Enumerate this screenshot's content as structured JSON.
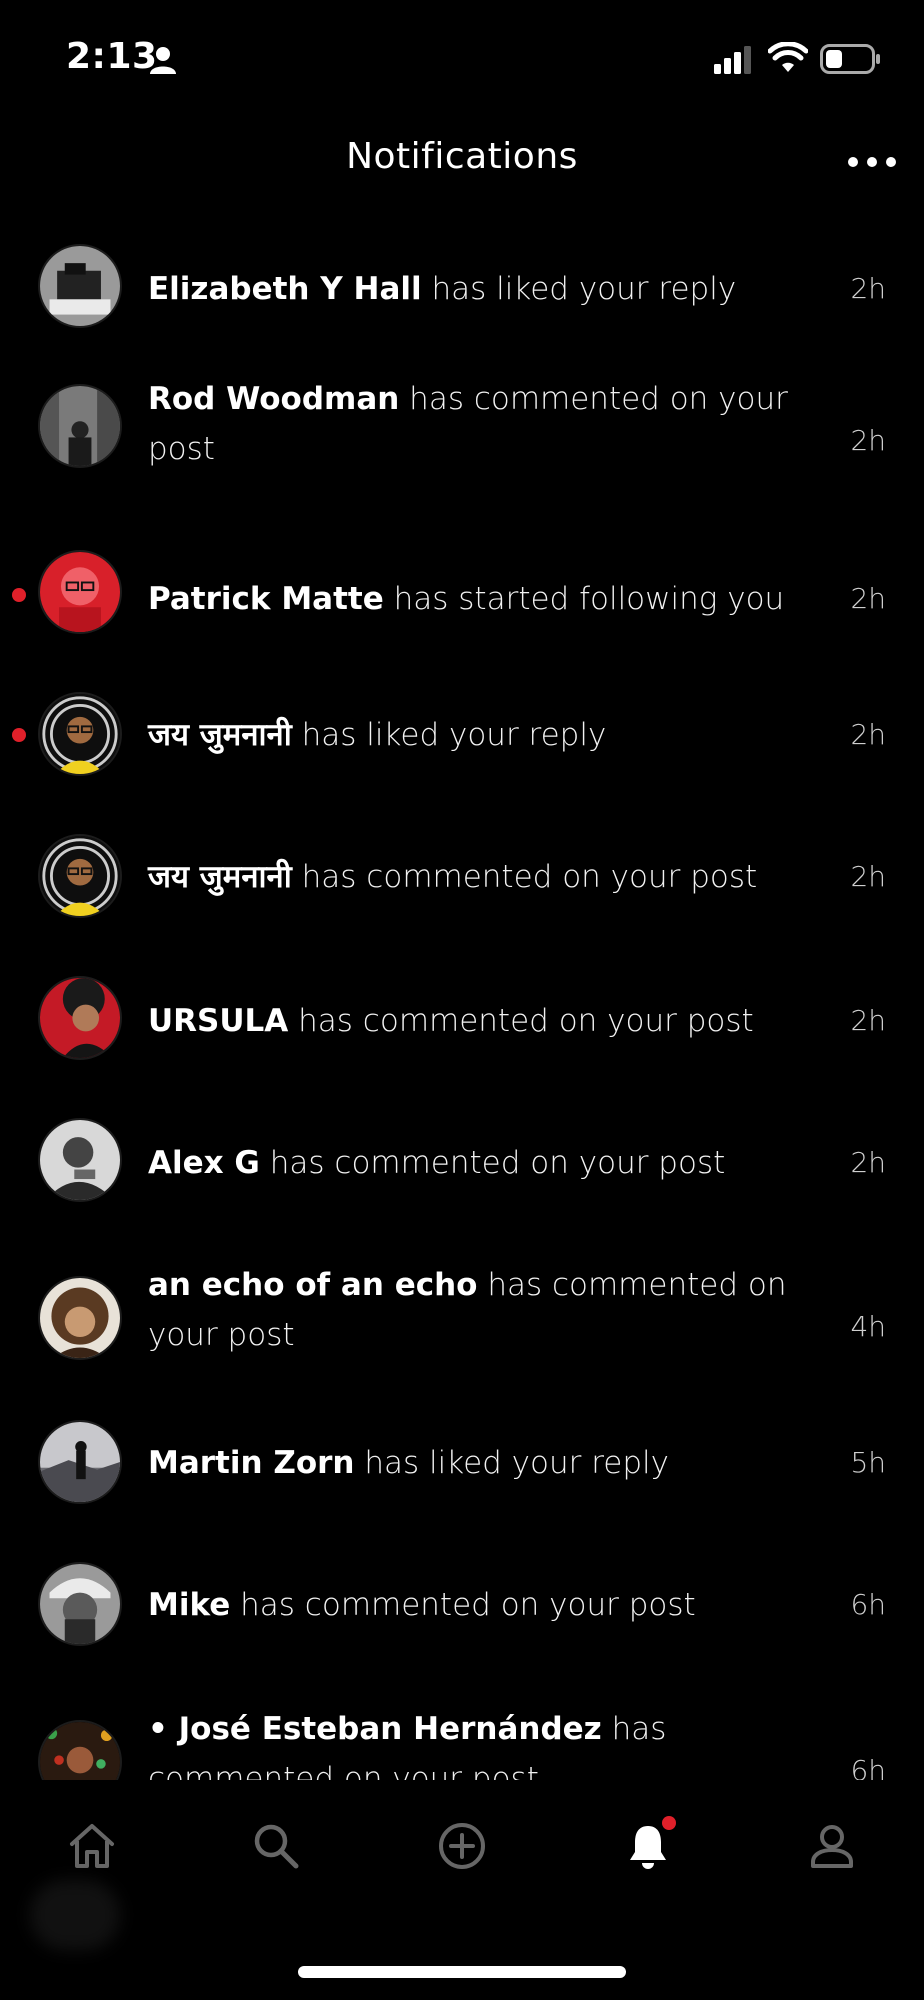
{
  "status_bar": {
    "time": "2:13"
  },
  "header": {
    "title": "Notifications",
    "more_icon": "more-horizontal-icon"
  },
  "notifications": [
    {
      "user": "Elizabeth Y Hall",
      "action": "has liked your reply",
      "time": "2h",
      "unread": false
    },
    {
      "user": "Rod Woodman",
      "action": " has commented on your post",
      "time": "2h",
      "unread": false
    },
    {
      "user": "Patrick Matte",
      "action": "has started following you",
      "time": "2h",
      "unread": true
    },
    {
      "user": "जय जुमनानी",
      "action": "has liked your reply",
      "time": "2h",
      "unread": true
    },
    {
      "user": "जय जुमनानी",
      "action": "has commented on your post",
      "time": "2h",
      "unread": false
    },
    {
      "user": "URSULA",
      "action": "has commented on your post",
      "time": "2h",
      "unread": false
    },
    {
      "user": "Alex G",
      "action": "has commented on your post",
      "time": "2h",
      "unread": false
    },
    {
      "user": "an echo of an echo",
      "action": "has commented on your post",
      "time": "4h",
      "unread": false
    },
    {
      "user": "Martin Zorn",
      "action": "has liked your reply",
      "time": "5h",
      "unread": false
    },
    {
      "user": "Mike",
      "action": "has commented on your post",
      "time": "6h",
      "unread": false
    },
    {
      "user": "• José Esteban Hernández",
      "action": "has commented on your post",
      "time": "6h",
      "unread": false
    }
  ],
  "tab_bar": {
    "items": [
      {
        "name": "home",
        "icon": "home-icon"
      },
      {
        "name": "search",
        "icon": "search-icon"
      },
      {
        "name": "create",
        "icon": "add-circle-icon"
      },
      {
        "name": "notifications",
        "icon": "bell-icon",
        "active": true,
        "badge": true
      },
      {
        "name": "profile",
        "icon": "profile-icon"
      }
    ]
  },
  "colors": {
    "background": "#000000",
    "accent": "#e0202a",
    "text": "#ffffff",
    "muted": "#cfcfcf"
  }
}
